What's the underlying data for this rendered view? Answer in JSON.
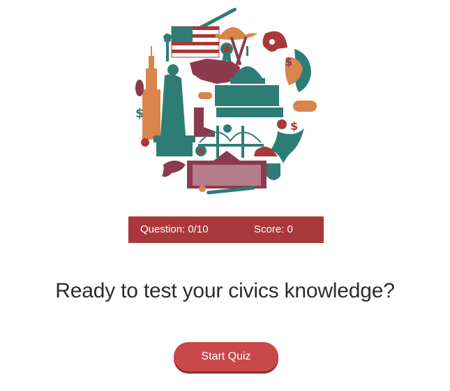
{
  "colors": {
    "accent_dark": "#a8383b",
    "accent": "#c9484a",
    "teal": "#2e7d74",
    "orange": "#d9854c",
    "maroon": "#8c3a4f"
  },
  "hero": {
    "icon": "americana-collage-icon"
  },
  "status": {
    "question_label": "Question: 0/10",
    "score_label": "Score: 0"
  },
  "main": {
    "prompt": "Ready to test your civics knowledge?"
  },
  "actions": {
    "start_label": "Start Quiz"
  }
}
